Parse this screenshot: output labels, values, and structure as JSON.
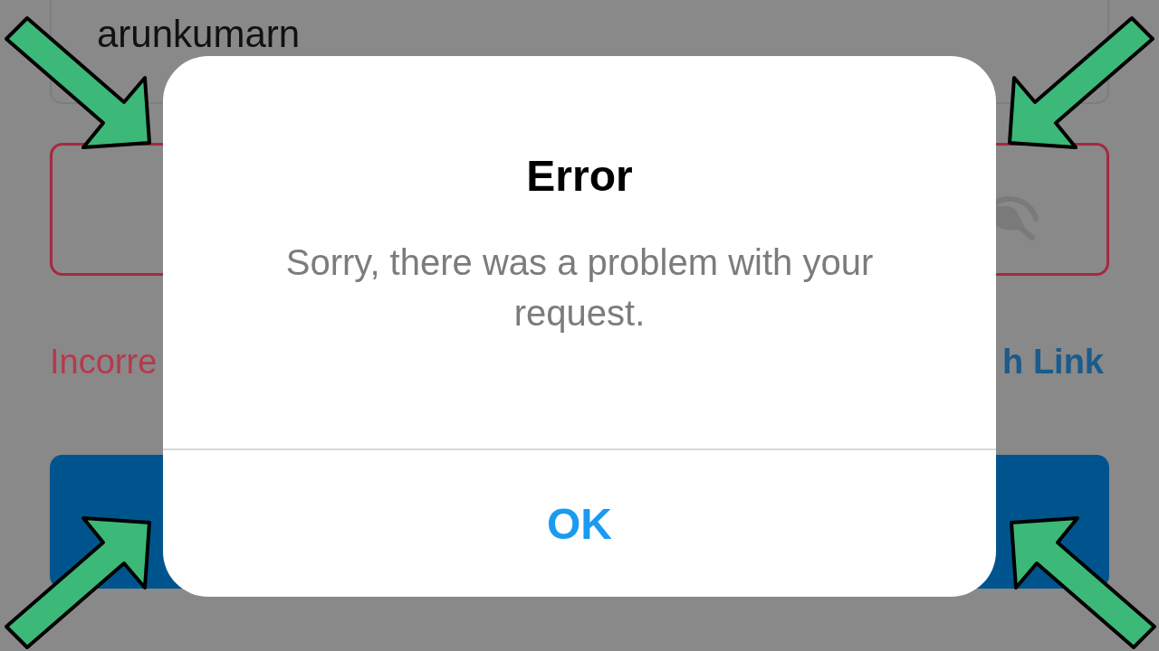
{
  "background": {
    "username_field": {
      "value": "arunkumarn"
    },
    "password_field": {
      "error": true
    },
    "error_text": "Incorre",
    "link_text": "h Link"
  },
  "dialog": {
    "title": "Error",
    "message": "Sorry, there was a problem with your request.",
    "buttons": [
      {
        "label": "OK"
      }
    ]
  }
}
